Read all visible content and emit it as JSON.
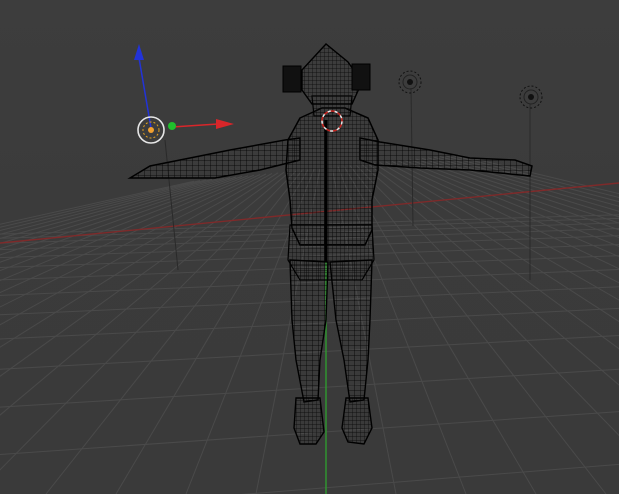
{
  "viewport": {
    "view_mode": "wireframe",
    "objects": [
      {
        "name": "character-mesh",
        "icon": "wireframe-mesh"
      },
      {
        "name": "camera-lamp-left",
        "icon": "lamp-icon"
      },
      {
        "name": "camera-lamp-right",
        "icon": "lamp-icon"
      },
      {
        "name": "object-origin",
        "icon": "origin-icon"
      }
    ]
  },
  "gizmo": {
    "x_axis_color": "#d9262a",
    "y_axis_color": "#1fbf2c",
    "z_axis_color": "#2233d8"
  },
  "colors": {
    "background": "#3c3c3c",
    "grid": "#4a4a4a",
    "x_axis_line": "#8a2a2a",
    "y_axis_line": "#2e8a2e",
    "wire": "#000000",
    "cursor": "#d0d0d0"
  }
}
